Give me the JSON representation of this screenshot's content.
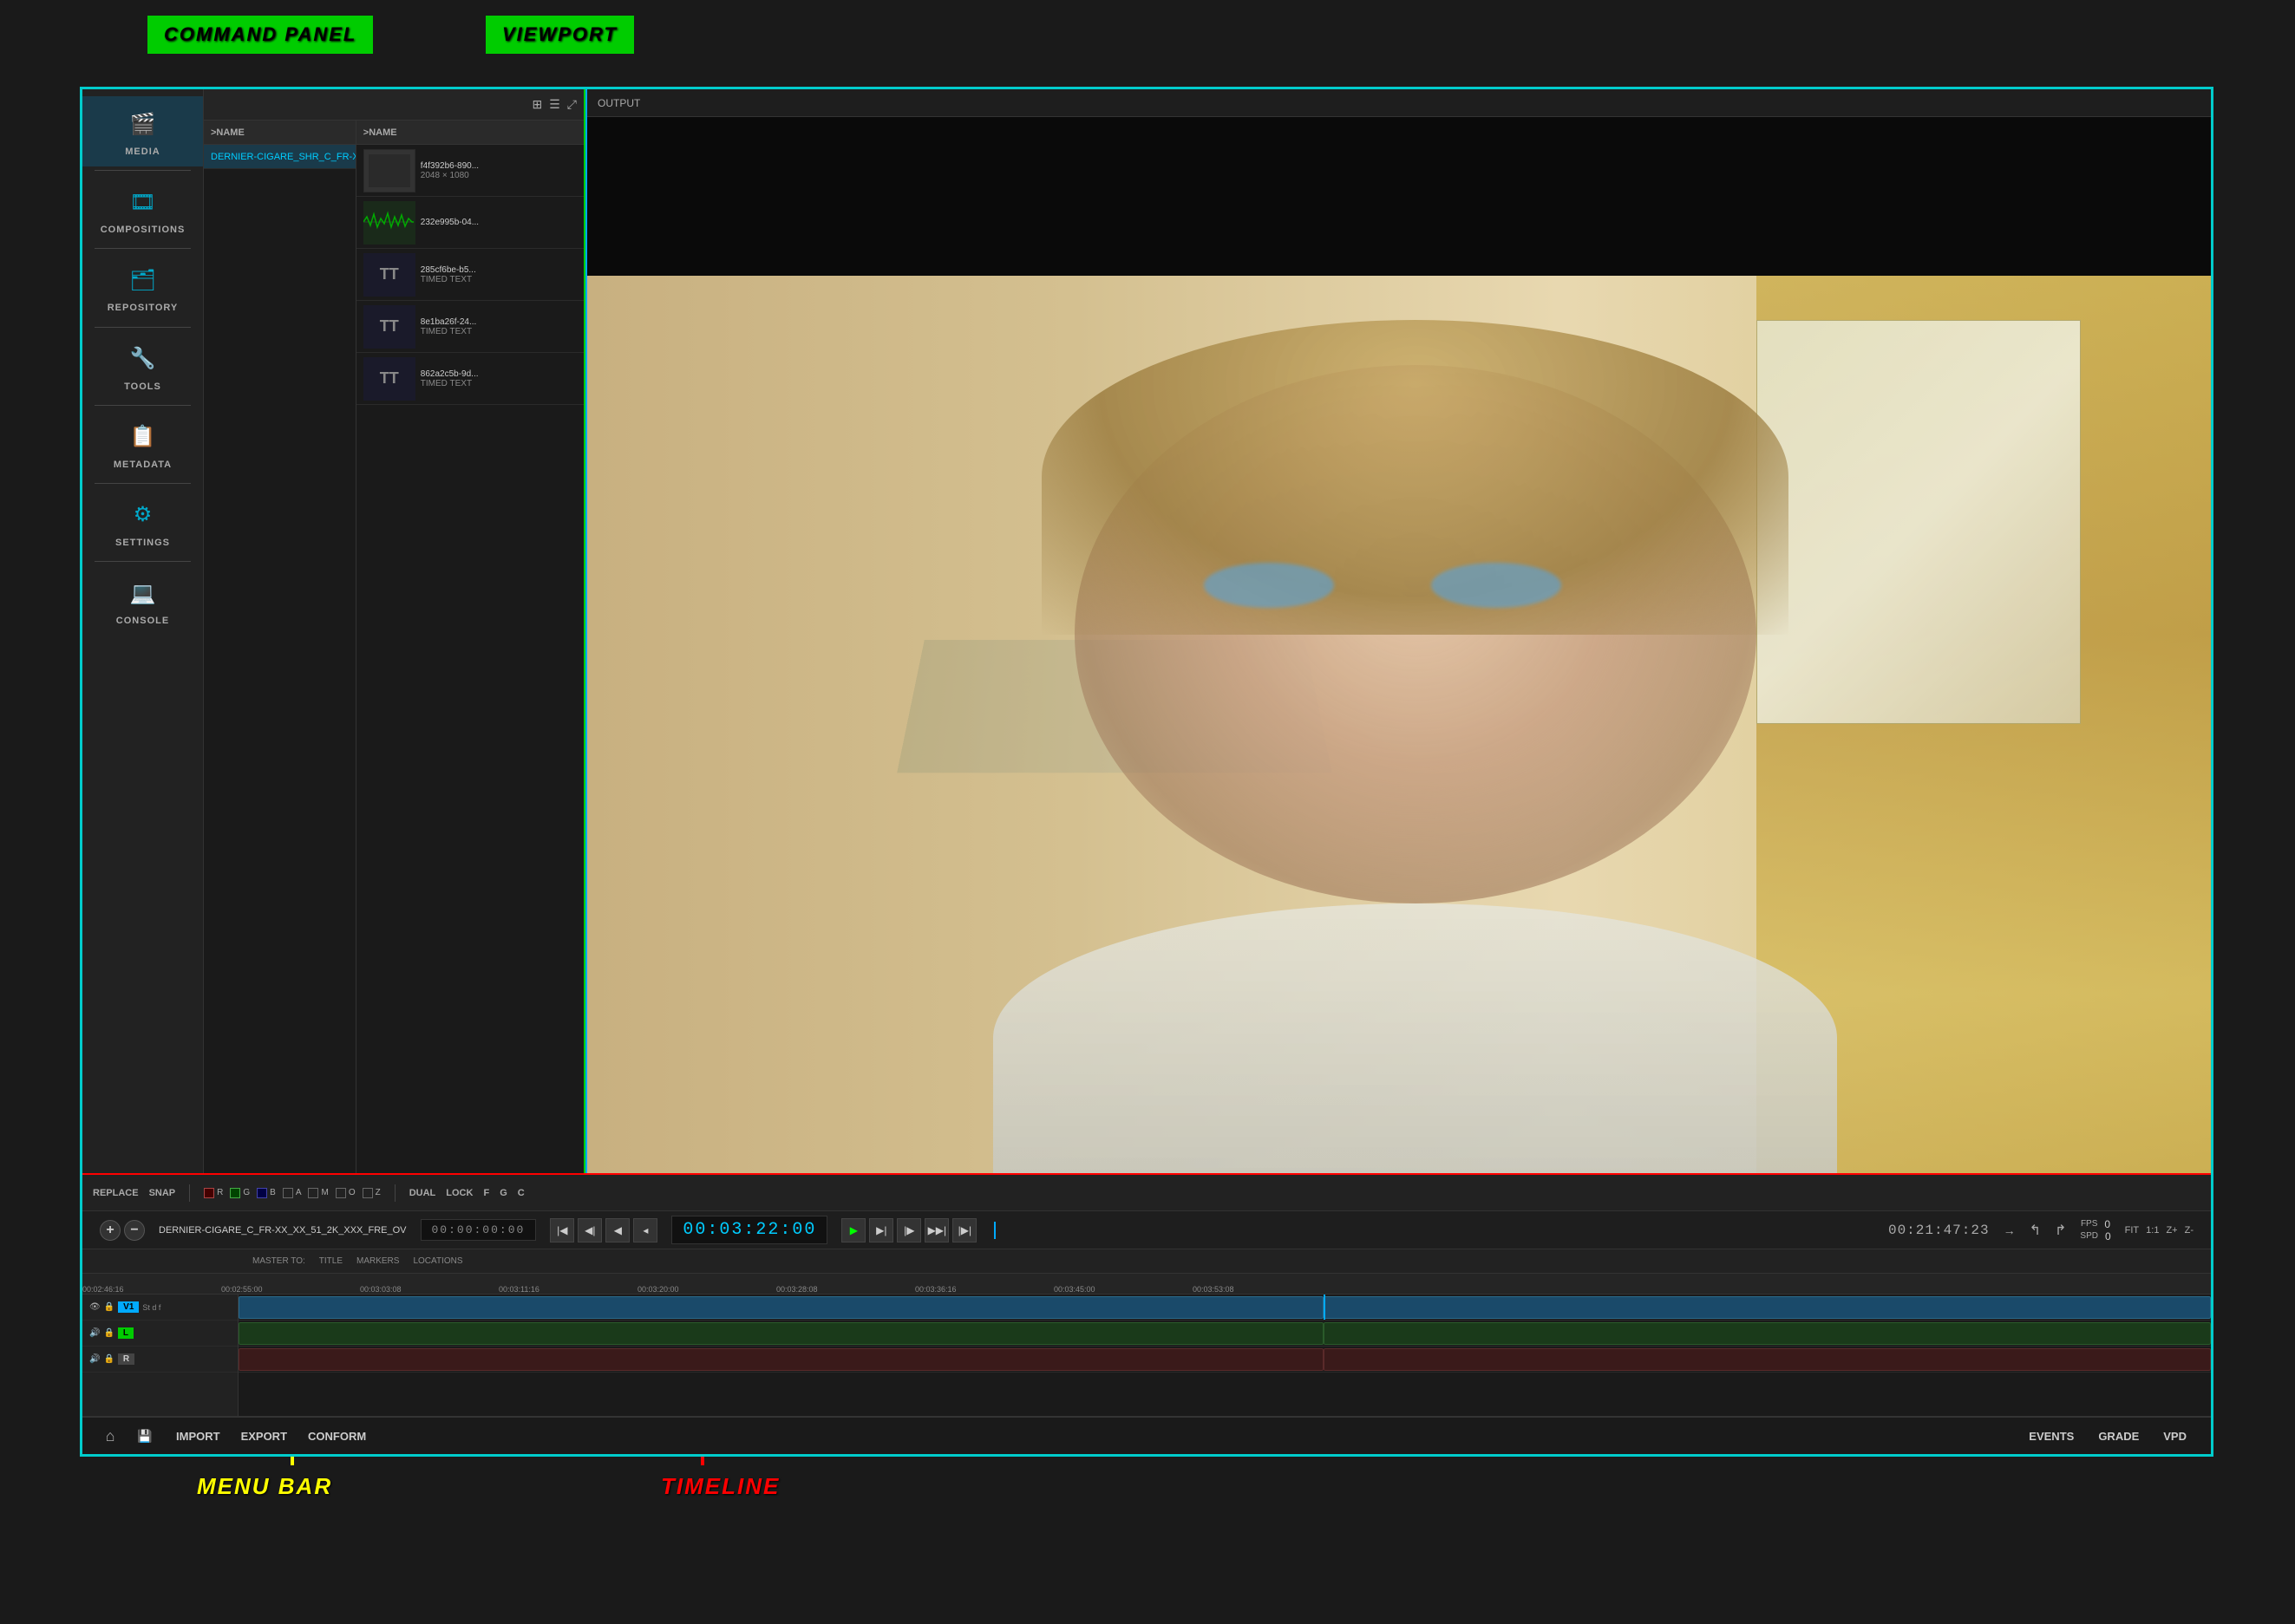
{
  "labels": {
    "command_panel": "COMMAND PANEL",
    "viewport": "VIEWPORT",
    "menu_bar": "MENU BAR",
    "timeline": "TIMELINE"
  },
  "sidebar": {
    "items": [
      {
        "id": "media",
        "label": "MEDIA",
        "icon": "🎬"
      },
      {
        "id": "compositions",
        "label": "COMPOSITIONS",
        "icon": "🎞"
      },
      {
        "id": "repository",
        "label": "REPOSITORY",
        "icon": "🗂"
      },
      {
        "id": "tools",
        "label": "ToOLS",
        "icon": "🔧"
      },
      {
        "id": "metadata",
        "label": "METADATA",
        "icon": "📋"
      },
      {
        "id": "settings",
        "label": "SETTINGS",
        "icon": "⚙"
      },
      {
        "id": "console",
        "label": "CONSOLE",
        "icon": "💻"
      }
    ]
  },
  "command_panel": {
    "col1_header": ">NAME",
    "col2_header": ">NAME",
    "items_col1": [
      "DERNIER-CIGARE_SHR_C_FR-XX_XX..."
    ],
    "items_col2": [
      {
        "name": "f4f392b6-890...",
        "sub": "2048 × 1080",
        "type": "video"
      },
      {
        "name": "232e995b-04...",
        "sub": "",
        "type": "audio"
      },
      {
        "name": "285cf6be-b5...",
        "sub": "TIMED TEXT",
        "type": "text"
      },
      {
        "name": "8e1ba26f-24...",
        "sub": "TIMED TEXT",
        "type": "text"
      },
      {
        "name": "862a2c5b-9d...",
        "sub": "TIMED TEXT",
        "type": "text"
      }
    ],
    "icons": [
      "grid",
      "list",
      "expand"
    ]
  },
  "viewport": {
    "header_label": "OUTPUT",
    "content": "video_frame"
  },
  "transport": {
    "sequence_name": "DERNIER-CIGARE_C_FR-XX_XX_51_2K_XXX_FRE_OV",
    "tc_in": "00:00:00:00",
    "tc_current": "00:03:22:00",
    "tc_out": "00:21:47:23",
    "fps_label": "FPS",
    "fps_value": "0",
    "spd_label": "SPD",
    "spd_value": "0",
    "fit_label": "FIT",
    "ratio_label": "1:1",
    "zoom_in": "Z+",
    "zoom_out": "Z-",
    "buttons": [
      "⏮",
      "⏮",
      "⏭",
      "⏪",
      "◀",
      "▶",
      "⏩",
      "⏭",
      "⏭"
    ]
  },
  "timeline": {
    "replace_label": "REPLACE",
    "snap_label": "SNAP",
    "channels": [
      "R",
      "G",
      "B",
      "A",
      "M",
      "O",
      "Z"
    ],
    "dual_label": "DUAL",
    "lock_label": "LOCK",
    "f_label": "F",
    "g_label": "G",
    "c_label": "C",
    "ruler_marks": [
      "00:02:46:16",
      "00:02:55:00",
      "00:03:03:08",
      "00:03:11:16",
      "00:03:20:00",
      "00:03:28:08",
      "00:03:36:16",
      "00:03:45:00",
      "00:03:53:08"
    ],
    "tracks": [
      {
        "id": "v1",
        "label": "V1",
        "type": "video"
      },
      {
        "id": "l",
        "label": "L",
        "type": "audio"
      },
      {
        "id": "r",
        "label": "R",
        "type": "audio"
      }
    ],
    "header_items": [
      "MASTER TO:",
      "TITLE",
      "MARKERS",
      "LOCATIONS"
    ]
  },
  "menu_bar": {
    "home_icon": "⌂",
    "save_icon": "💾",
    "items": [
      "IMPORT",
      "EXPORT",
      "CONFORM"
    ],
    "right_items": [
      "EVENTS",
      "GRADE",
      "VPD"
    ]
  }
}
